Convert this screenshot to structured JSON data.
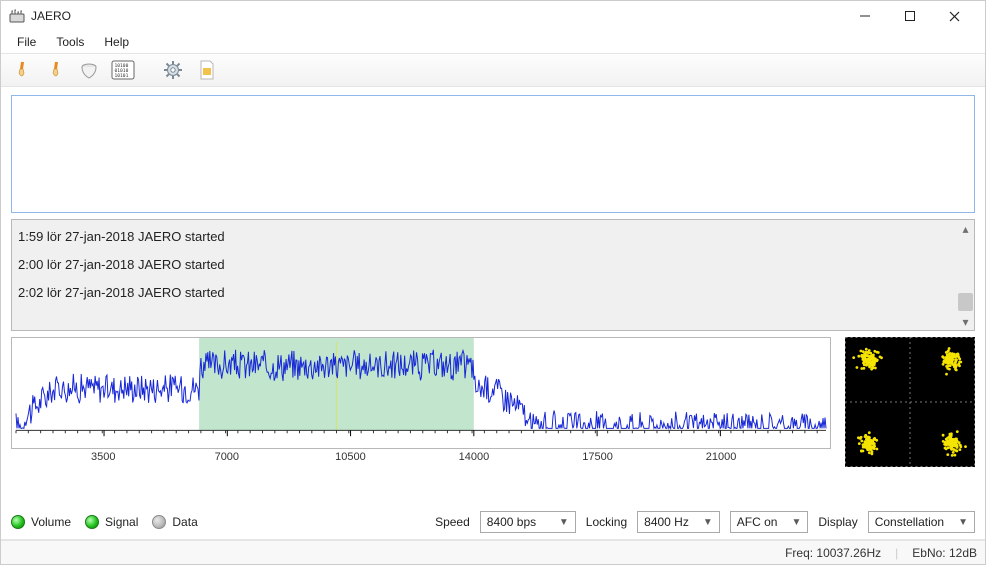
{
  "window": {
    "title": "JAERO"
  },
  "menu": {
    "items": [
      "File",
      "Tools",
      "Help"
    ]
  },
  "toolbar_icons": [
    "brush-a-icon",
    "brush-b-icon",
    "filter-icon",
    "binary-icon",
    "gear-icon",
    "page-icon"
  ],
  "log": {
    "lines": [
      "1:59 lör 27-jan-2018 JAERO started",
      "2:00 lör 27-jan-2018 JAERO started",
      "2:02 lör 27-jan-2018 JAERO started"
    ]
  },
  "leds": {
    "volume": {
      "label": "Volume",
      "state": "green"
    },
    "signal": {
      "label": "Signal",
      "state": "green"
    },
    "data": {
      "label": "Data",
      "state": "grey"
    }
  },
  "controls": {
    "speed": {
      "label": "Speed",
      "value": "8400 bps"
    },
    "locking": {
      "label": "Locking",
      "value": "8400 Hz"
    },
    "afc": {
      "value": "AFC on"
    },
    "display": {
      "label": "Display",
      "value": "Constellation"
    }
  },
  "status": {
    "freq_label": "Freq:",
    "freq_value": "10037.26Hz",
    "ebno_label": "EbNo:",
    "ebno_value": "12dB"
  },
  "chart_data": {
    "type": "line",
    "title": "",
    "xlabel": "",
    "ylabel": "",
    "xlim": [
      1000,
      24000
    ],
    "ylim": [
      0,
      100
    ],
    "ticks_x": [
      3500,
      7000,
      10500,
      14000,
      17500,
      21000
    ],
    "highlight_band": {
      "start": 6200,
      "end": 14000
    },
    "signal_band": {
      "start": 1250,
      "end": 15500
    },
    "signal_center_freq": 10100,
    "noise_floor_mean": 15,
    "signal_plateau_mean": 65,
    "jitter_amplitude": 18
  },
  "constellation_data": {
    "type": "scatter",
    "clusters": [
      {
        "cx": -0.7,
        "cy": 0.7
      },
      {
        "cx": 0.7,
        "cy": 0.7
      },
      {
        "cx": -0.7,
        "cy": -0.7
      },
      {
        "cx": 0.7,
        "cy": -0.7
      }
    ],
    "points_per_cluster": 90,
    "spread": 0.22,
    "color": "#f5e400"
  }
}
